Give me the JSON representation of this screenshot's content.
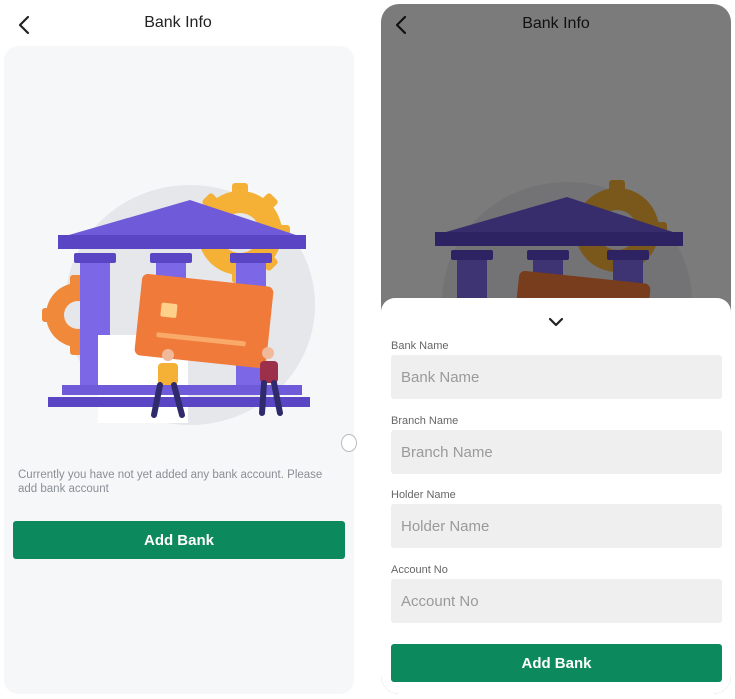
{
  "left": {
    "header": {
      "title": "Bank Info",
      "back_icon": "chevron-left-icon"
    },
    "empty_message": "Currently you have not yet added any bank account. Please add bank account",
    "add_bank_label": "Add Bank",
    "illustration": "bank-building-illustration"
  },
  "right": {
    "header": {
      "title": "Bank Info",
      "back_icon": "chevron-left-icon"
    },
    "sheet": {
      "collapse_icon": "chevron-down-icon",
      "fields": [
        {
          "label": "Bank Name",
          "placeholder": "Bank Name",
          "value": ""
        },
        {
          "label": "Branch Name",
          "placeholder": "Branch Name",
          "value": ""
        },
        {
          "label": "Holder Name",
          "placeholder": "Holder Name",
          "value": ""
        },
        {
          "label": "Account No",
          "placeholder": "Account No",
          "value": ""
        }
      ],
      "add_bank_label": "Add Bank"
    }
  },
  "colors": {
    "primary": "#0d8a5d",
    "building": "#6f5bd9",
    "gear": "#f4b136",
    "card": "#f07a3a",
    "overlay": "rgba(0,0,0,0.5)"
  }
}
